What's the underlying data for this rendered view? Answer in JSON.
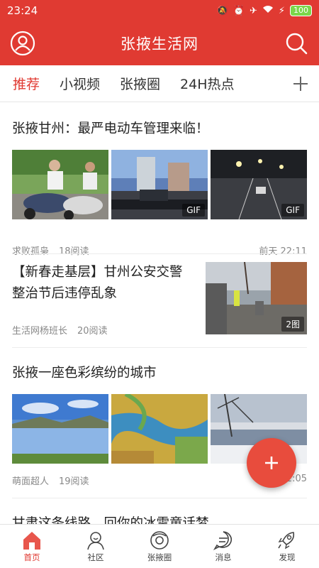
{
  "status": {
    "time": "23:24",
    "battery": "100"
  },
  "header": {
    "title": "张掖生活网"
  },
  "tabs": [
    {
      "label": "推荐",
      "active": true
    },
    {
      "label": "小视频"
    },
    {
      "label": "张掖圈"
    },
    {
      "label": "24H热点"
    }
  ],
  "feed": [
    {
      "title": "张掖甘州：最严电动车管理来临！",
      "author": "求败孤枭",
      "reads": "18阅读",
      "time": "前天 22:11",
      "badges": [
        "",
        "GIF",
        "GIF"
      ]
    },
    {
      "title": "【新春走基层】甘州公安交警整治节后违停乱象",
      "author": "生活网杨班长",
      "reads": "20阅读",
      "image_count": "2图"
    },
    {
      "title": "张掖一座色彩缤纷的城市",
      "author": "萌面超人",
      "reads": "19阅读",
      "time_partial": "2:05"
    },
    {
      "title": "甘肃这条线路，回你的冰雪童话梦"
    }
  ],
  "bottom_nav": [
    {
      "label": "首页",
      "active": true,
      "icon": "home-icon"
    },
    {
      "label": "社区",
      "icon": "community-icon"
    },
    {
      "label": "张掖圈",
      "icon": "circle-icon"
    },
    {
      "label": "消息",
      "icon": "message-icon"
    },
    {
      "label": "发现",
      "icon": "rocket-icon"
    }
  ],
  "colors": {
    "brand": "#e03a32",
    "fab": "#e84c3d"
  }
}
